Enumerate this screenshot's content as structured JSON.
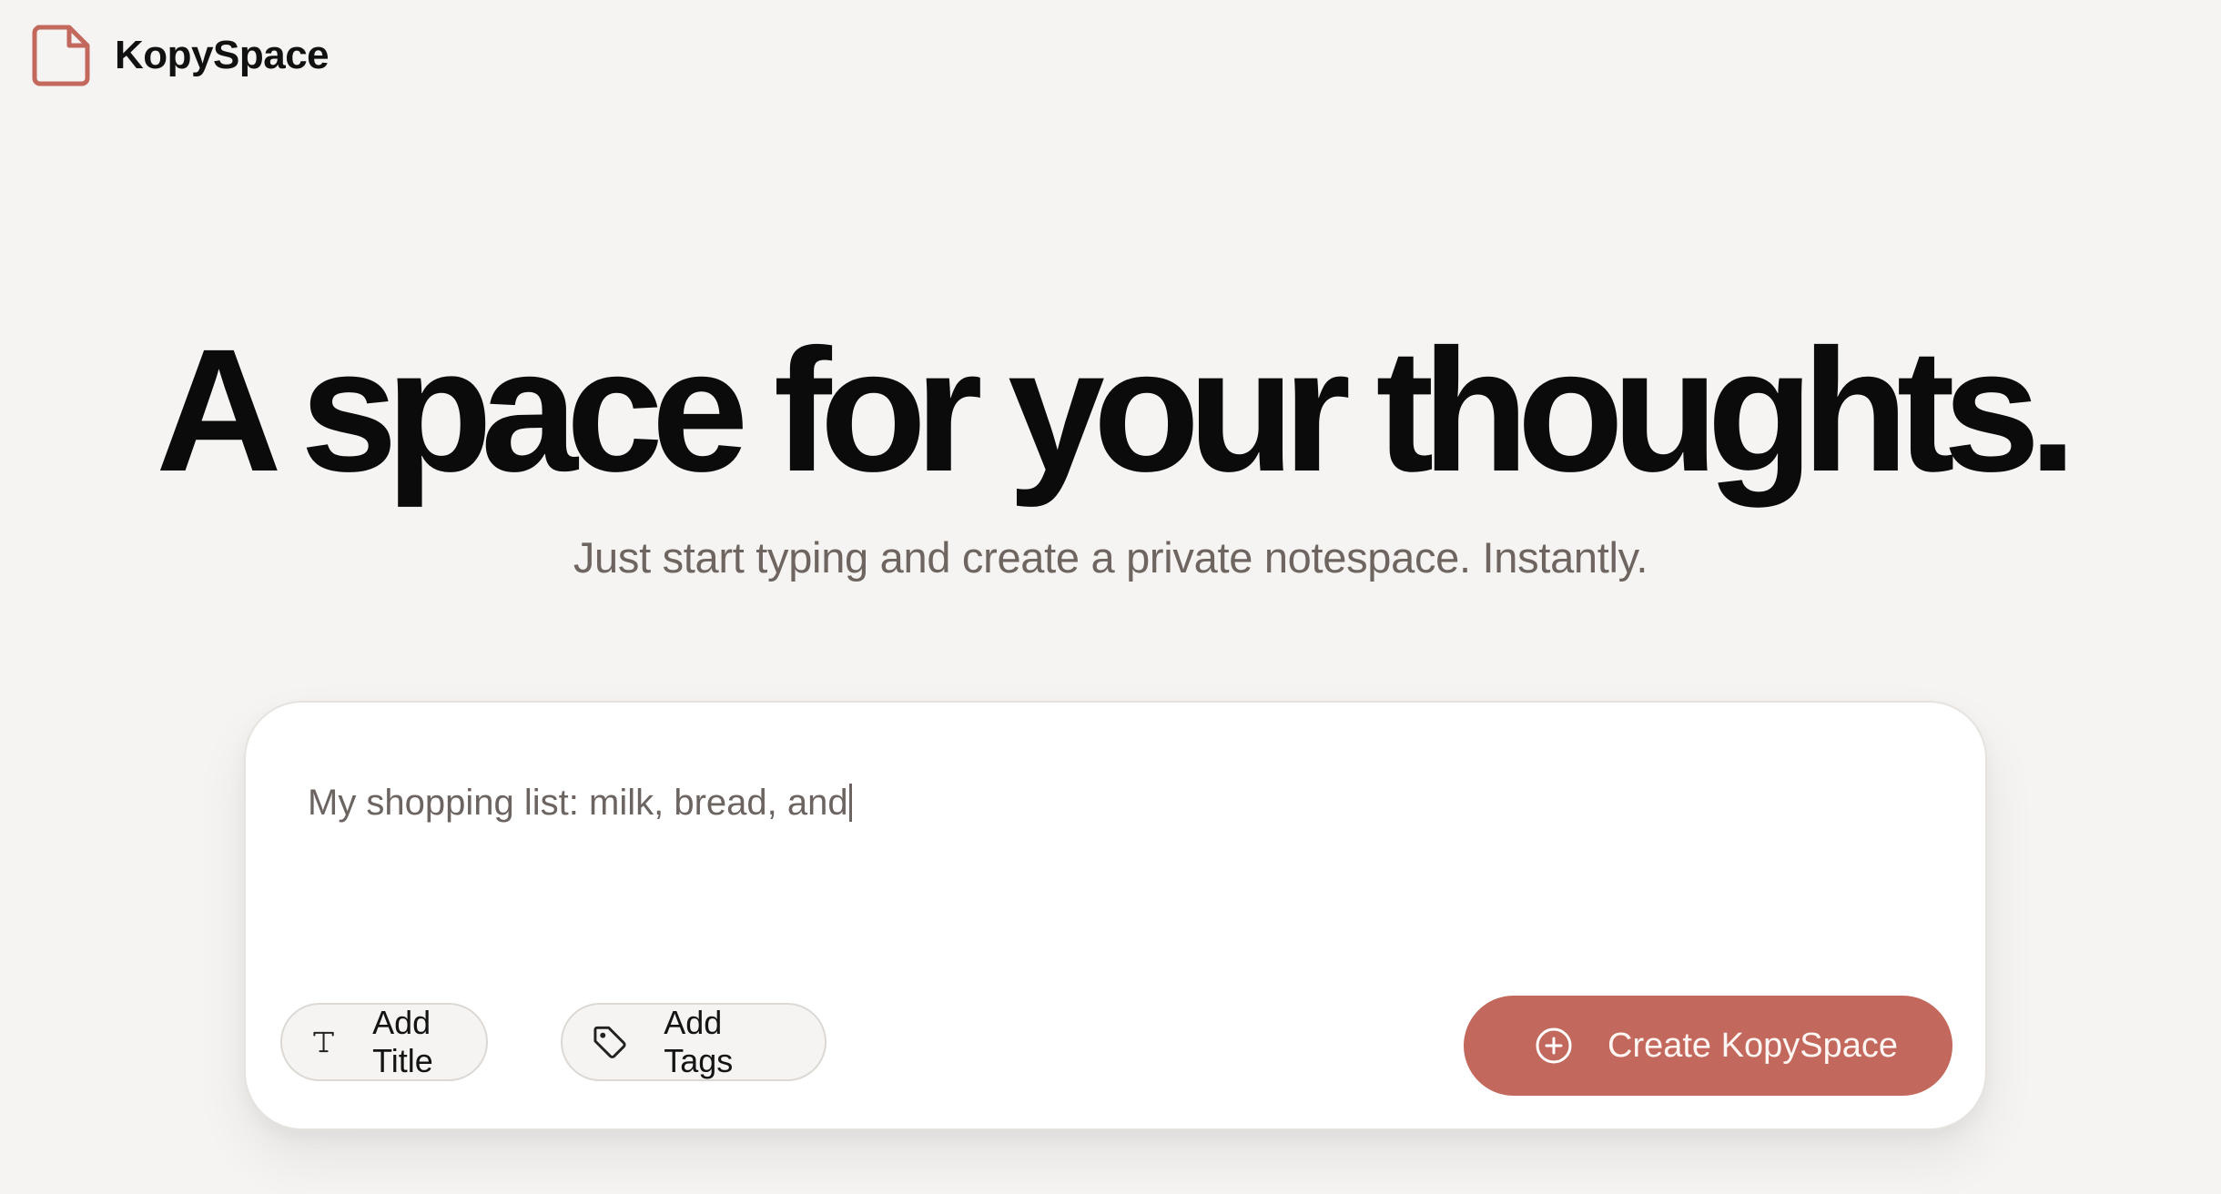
{
  "header": {
    "brand_name": "KopySpace",
    "logo_icon": "document-icon",
    "accent_color": "#c3685c"
  },
  "hero": {
    "title": "A space for your thoughts.",
    "subtitle": "Just start typing and create a private notespace. Instantly."
  },
  "editor": {
    "value": "My shopping list: milk, bread, and",
    "add_title_label": "Add Title",
    "add_title_icon": "text-t-icon",
    "add_tags_label": "Add Tags",
    "add_tags_icon": "tag-icon",
    "create_label": "Create KopySpace",
    "create_icon": "plus-circle-icon"
  }
}
